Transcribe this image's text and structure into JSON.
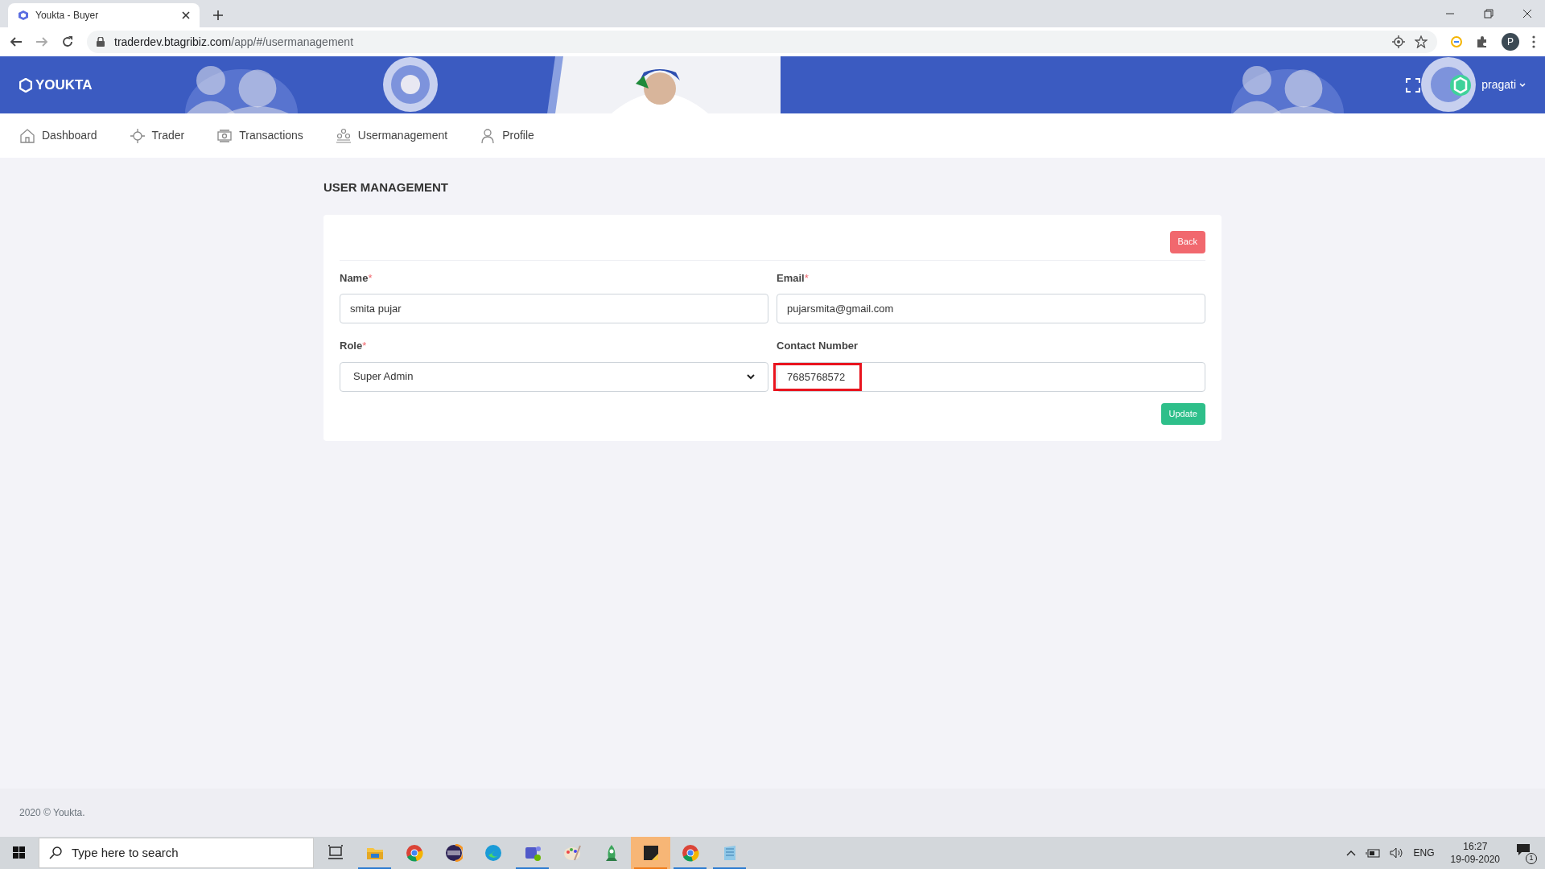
{
  "browser": {
    "tab": {
      "title": "Youkta - Buyer"
    },
    "url_host": "traderdev.btagribiz.com",
    "url_path": "/app/#/usermanagement"
  },
  "browser_profile": "P",
  "header": {
    "brand": "YOUKTA",
    "user": "pragati"
  },
  "nav": [
    {
      "label": "Dashboard",
      "kind": "home"
    },
    {
      "label": "Trader",
      "kind": "trader"
    },
    {
      "label": "Transactions",
      "kind": "money"
    },
    {
      "label": "Usermanagement",
      "kind": "users"
    },
    {
      "label": "Profile",
      "kind": "person"
    }
  ],
  "page_title": "USER MANAGEMENT",
  "form": {
    "required_marker": "*",
    "back": "Back",
    "update": "Update",
    "fields": [
      {
        "label": "Name",
        "required": true,
        "value": "smita pujar",
        "kind": "text",
        "highlighted": false
      },
      {
        "label": "Email",
        "required": true,
        "value": "pujarsmita@gmail.com",
        "kind": "text",
        "highlighted": false
      },
      {
        "label": "Role",
        "required": true,
        "value": "Super Admin",
        "kind": "select",
        "highlighted": false
      },
      {
        "label": "Contact Number",
        "required": false,
        "value": "7685768572",
        "kind": "text",
        "highlighted": true
      }
    ]
  },
  "footer": "2020 © Youkta.",
  "taskbar": {
    "search_placeholder": "Type here to search",
    "apps": [
      {
        "kind": "taskview",
        "open": false,
        "selected": false
      },
      {
        "kind": "folder",
        "open": true,
        "selected": false
      },
      {
        "kind": "chrome",
        "open": false,
        "selected": false
      },
      {
        "kind": "eclipse",
        "open": false,
        "selected": false
      },
      {
        "kind": "edge",
        "open": false,
        "selected": false
      },
      {
        "kind": "teams",
        "open": true,
        "selected": false
      },
      {
        "kind": "paint",
        "open": false,
        "selected": false
      },
      {
        "kind": "rocket",
        "open": false,
        "selected": false
      },
      {
        "kind": "sticky",
        "open": true,
        "selected": true
      },
      {
        "kind": "chrome",
        "open": true,
        "selected": false
      },
      {
        "kind": "notepad",
        "open": true,
        "selected": false
      }
    ],
    "lang": "ENG",
    "time": "16:27",
    "date": "19-09-2020",
    "notifications": "1"
  }
}
